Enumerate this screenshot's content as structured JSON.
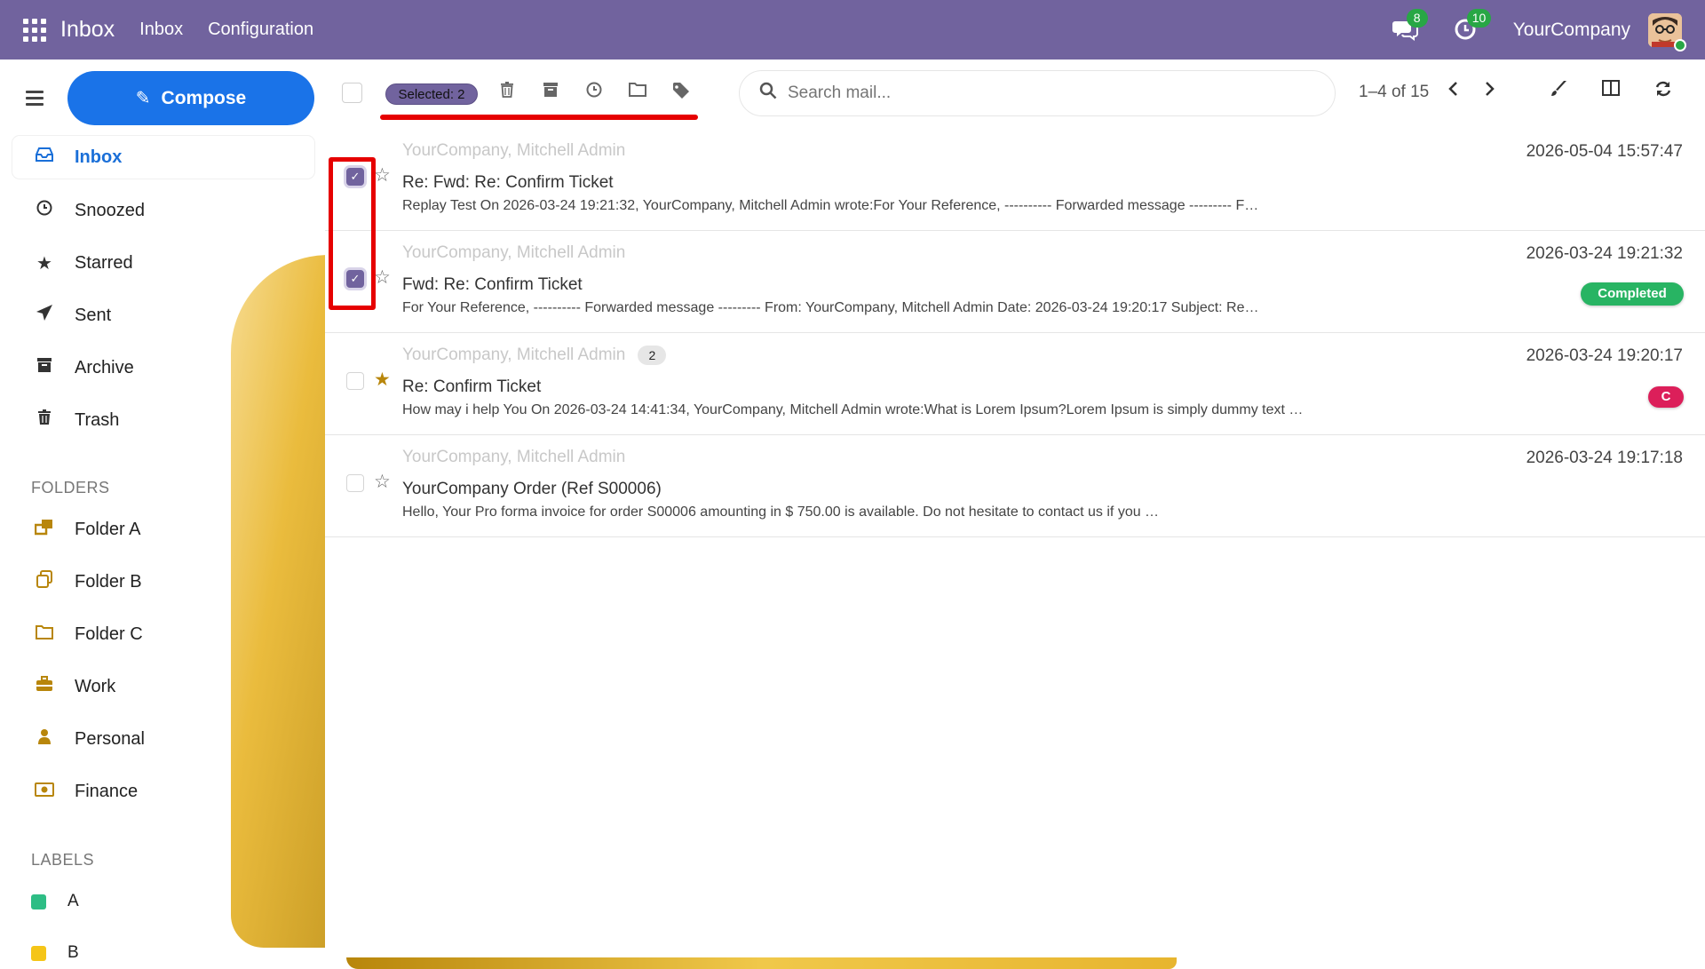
{
  "topbar": {
    "app_name": "Inbox",
    "nav": [
      "Inbox",
      "Configuration"
    ],
    "messages_count": "8",
    "activities_count": "10",
    "company": "YourCompany"
  },
  "sidebar": {
    "compose_label": "Compose",
    "mailboxes": [
      {
        "label": "Inbox",
        "icon": "inbox-icon"
      },
      {
        "label": "Snoozed",
        "icon": "clock-icon"
      },
      {
        "label": "Starred",
        "icon": "star-icon"
      },
      {
        "label": "Sent",
        "icon": "paper-plane-icon"
      },
      {
        "label": "Archive",
        "icon": "archive-icon"
      },
      {
        "label": "Trash",
        "icon": "trash-icon"
      }
    ],
    "folders_heading": "FOLDERS",
    "folders": [
      {
        "label": "Folder A",
        "icon": "folders-icon"
      },
      {
        "label": "Folder B",
        "icon": "copy-icon"
      },
      {
        "label": "Folder C",
        "icon": "folder-icon"
      },
      {
        "label": "Work",
        "icon": "briefcase-icon"
      },
      {
        "label": "Personal",
        "icon": "user-icon"
      },
      {
        "label": "Finance",
        "icon": "money-icon"
      }
    ],
    "labels_heading": "LABELS",
    "labels": [
      {
        "label": "A",
        "color": "#2ebd85"
      },
      {
        "label": "B",
        "color": "#f5c518"
      }
    ]
  },
  "toolbar": {
    "selected_label": "Selected: 2",
    "search_placeholder": "Search mail...",
    "pager": "1–4 of 15"
  },
  "messages": [
    {
      "sender": "YourCompany, Mitchell Admin",
      "subject": "Re: Fwd: Re: Confirm Ticket",
      "preview": "Replay Test On 2026-03-24 19:21:32, YourCompany, Mitchell Admin wrote:For Your Reference, ---------- Forwarded message --------- F…",
      "date": "2026-05-04 15:57:47",
      "selected": true,
      "starred": false
    },
    {
      "sender": "YourCompany, Mitchell Admin",
      "subject": "Fwd: Re: Confirm Ticket",
      "preview": "For Your Reference, ---------- Forwarded message --------- From: YourCompany, Mitchell Admin Date: 2026-03-24 19:20:17 Subject: Re…",
      "date": "2026-03-24 19:21:32",
      "tag": "Completed",
      "selected": true,
      "starred": false
    },
    {
      "sender": "YourCompany, Mitchell Admin",
      "count": "2",
      "subject": "Re: Confirm Ticket",
      "preview": "How may i help You On 2026-03-24 14:41:34, YourCompany, Mitchell Admin wrote:What is Lorem Ipsum?Lorem Ipsum is simply dummy text …",
      "date": "2026-03-24 19:20:17",
      "tag": "C",
      "selected": false,
      "starred": true
    },
    {
      "sender": "YourCompany, Mitchell Admin",
      "subject": "YourCompany Order (Ref S00006)",
      "preview": "Hello, Your Pro forma invoice for order S00006 amounting in $ 750.00 is available. Do not hesitate to contact us if you …",
      "date": "2026-03-24 19:17:18",
      "selected": false,
      "starred": false
    }
  ],
  "colors": {
    "topbar": "#71639e",
    "compose": "#1a73e8",
    "completed_tag": "#28b463",
    "c_tag": "#dc1f5a",
    "annotation": "#e60000"
  }
}
